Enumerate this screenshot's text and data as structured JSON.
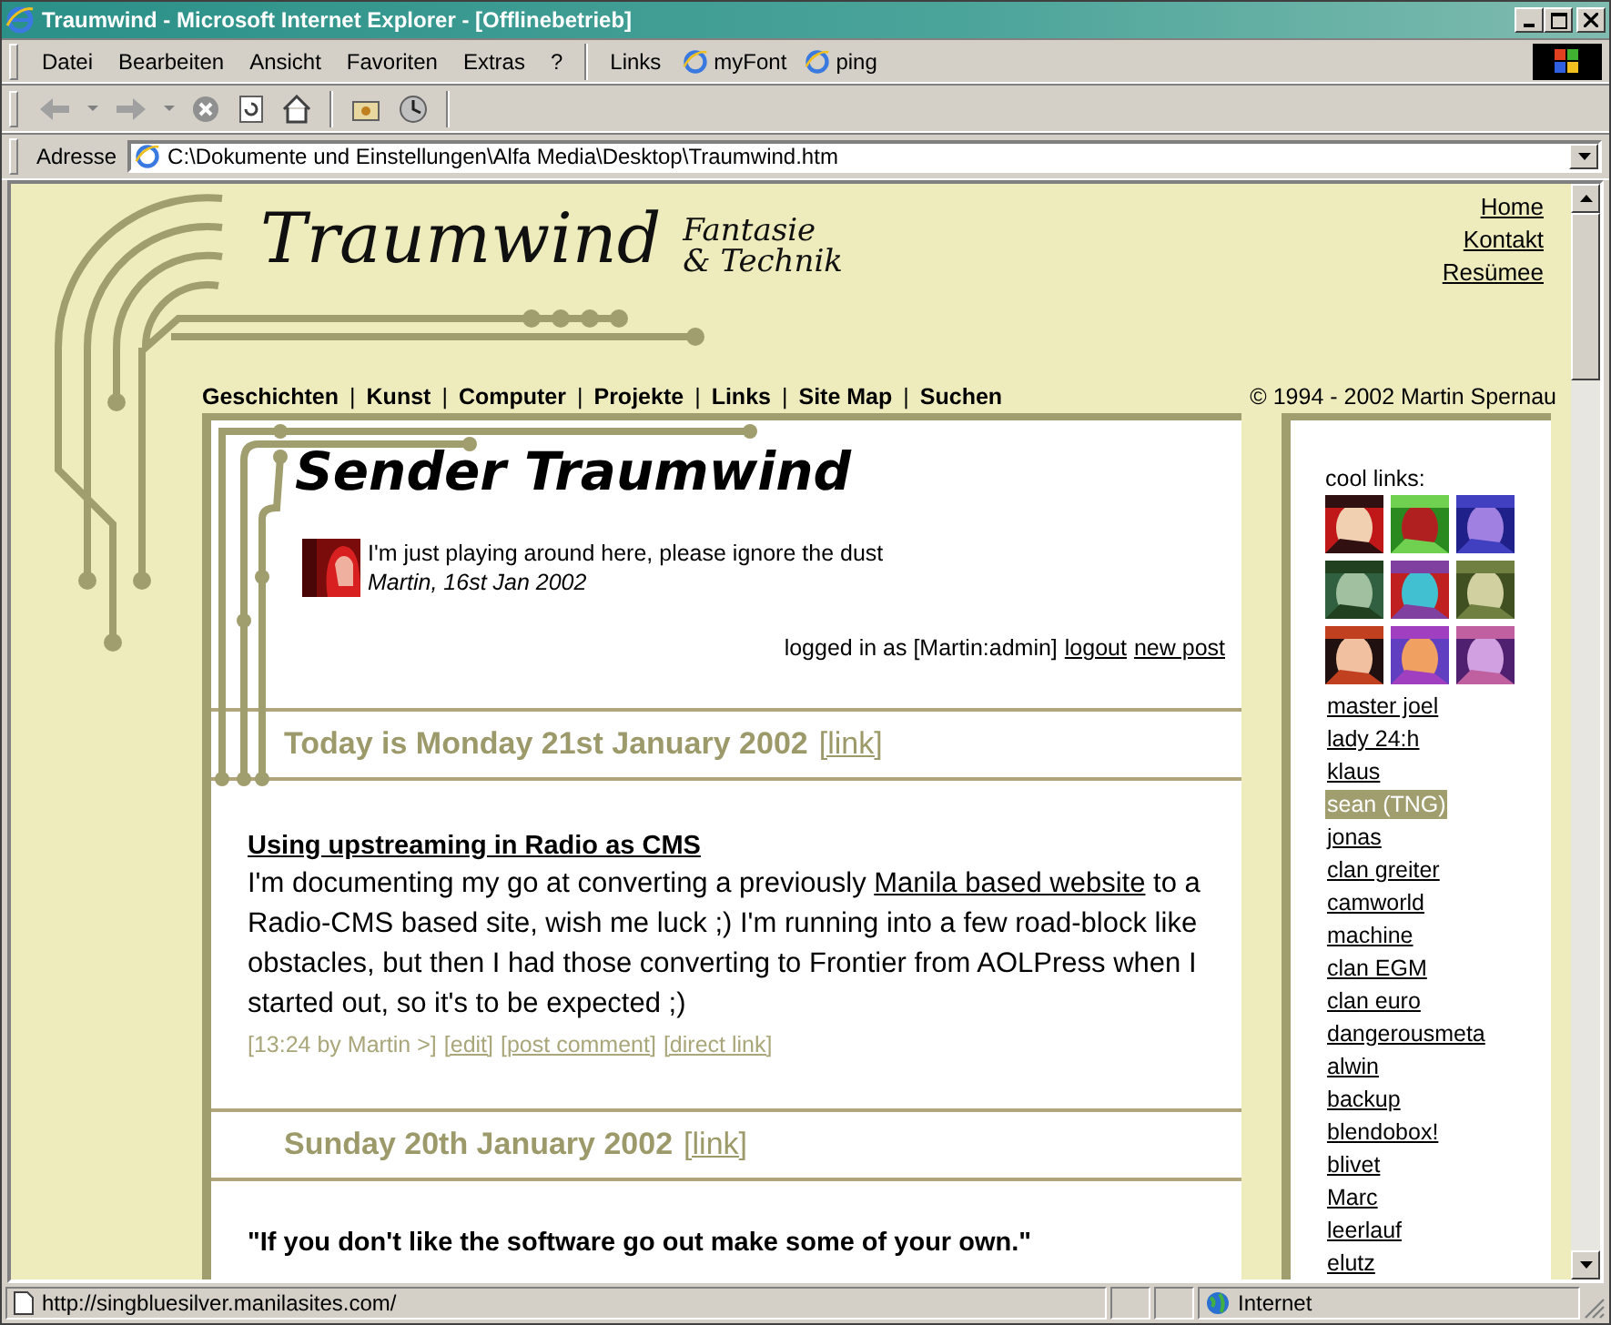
{
  "window": {
    "title": "Traumwind - Microsoft Internet Explorer - [Offlinebetrieb]"
  },
  "menu": [
    "Datei",
    "Bearbeiten",
    "Ansicht",
    "Favoriten",
    "Extras",
    "?"
  ],
  "links_bar": {
    "label": "Links",
    "items": [
      "myFont",
      "ping"
    ]
  },
  "address": {
    "label": "Adresse",
    "value": "C:\\Dokumente und Einstellungen\\Alfa Media\\Desktop\\Traumwind.htm"
  },
  "site": {
    "logo": "Traumwind",
    "tagline": [
      "Fantasie",
      "& Technik"
    ],
    "top_links": [
      "Home",
      "Kontakt",
      "Resümee"
    ],
    "nav": [
      "Geschichten",
      "Kunst",
      "Computer",
      "Projekte",
      "Links",
      "Site Map",
      "Suchen"
    ],
    "nav_separator": "|",
    "copyright": "© 1994 - 2002 Martin Spernau"
  },
  "blog": {
    "title": "Sender Traumwind",
    "motto": "I'm just playing around here, please ignore the dust",
    "motto_by": "Martin, 16st Jan 2002",
    "login_text": "logged in as [Martin:admin]",
    "login_links": [
      "logout",
      "new post"
    ],
    "days": [
      {
        "heading": "Today is Monday 21st January 2002",
        "link": "[link]",
        "posts": [
          {
            "kind": "article",
            "title": "Using upstreaming in Radio as CMS",
            "lines": [
              [
                {
                  "text": "I'm documenting my go at converting a previously ",
                  "link": false
                },
                {
                  "text": "Manila based website",
                  "link": true
                },
                {
                  "text": " to a",
                  "link": false
                }
              ],
              [
                {
                  "text": "Radio-CMS based site, wish me luck ;) I'm running into a few road-block like",
                  "link": false
                }
              ],
              [
                {
                  "text": "obstacles, but then I had those converting to Frontier from AOLPress when I",
                  "link": false
                }
              ],
              [
                {
                  "text": "started out, so it's to be expected ;)",
                  "link": false
                }
              ]
            ],
            "meta": "[13:24 by Martin >]",
            "actions": [
              "[edit]",
              "[post comment]",
              "[direct link]"
            ]
          }
        ]
      },
      {
        "heading": "Sunday 20th January 2002",
        "link": "[link]",
        "posts": [
          {
            "kind": "quote",
            "title": "\"If you don't like the software go out make some of your own.\""
          }
        ]
      }
    ]
  },
  "sidebar": {
    "heading": "cool links:",
    "links": [
      {
        "label": "master joel",
        "selected": false
      },
      {
        "label": "lady 24:h",
        "selected": false
      },
      {
        "label": "klaus",
        "selected": false
      },
      {
        "label": "sean (TNG)",
        "selected": true
      },
      {
        "label": "jonas",
        "selected": false
      },
      {
        "label": "clan greiter",
        "selected": false
      },
      {
        "label": "camworld",
        "selected": false
      },
      {
        "label": "machine",
        "selected": false
      },
      {
        "label": "clan EGM",
        "selected": false
      },
      {
        "label": "clan euro",
        "selected": false
      },
      {
        "label": "dangerousmeta",
        "selected": false
      },
      {
        "label": "alwin",
        "selected": false
      },
      {
        "label": "backup",
        "selected": false
      },
      {
        "label": "blendobox!",
        "selected": false
      },
      {
        "label": "blivet",
        "selected": false
      },
      {
        "label": "Marc",
        "selected": false
      },
      {
        "label": "leerlauf",
        "selected": false
      },
      {
        "label": "elutz",
        "selected": false
      }
    ]
  },
  "status_bar": {
    "url": "http://singbluesilver.manilasites.com/",
    "zone": "Internet"
  }
}
